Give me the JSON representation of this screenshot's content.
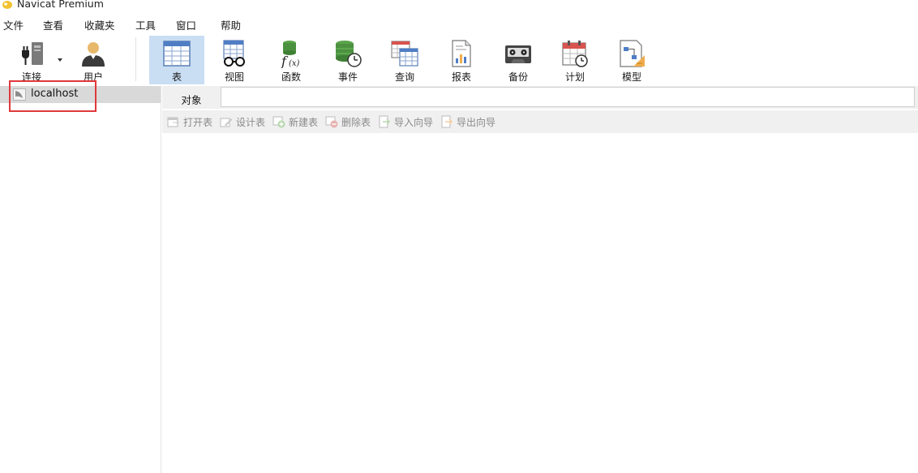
{
  "window": {
    "title": "Navicat Premium"
  },
  "menu": [
    "文件",
    "查看",
    "收藏夹",
    "工具",
    "窗口",
    "帮助"
  ],
  "toolbar": {
    "connect_label": "连接",
    "user_label": "用户",
    "table_label": "表",
    "view_label": "视图",
    "function_label": "函数",
    "event_label": "事件",
    "query_label": "查询",
    "report_label": "报表",
    "backup_label": "备份",
    "schedule_label": "计划",
    "model_label": "模型"
  },
  "sidebar": {
    "connections": [
      {
        "label": "localhost"
      }
    ]
  },
  "tabs": {
    "object_label": "对象"
  },
  "actions": {
    "open_table": "打开表",
    "design_table": "设计表",
    "new_table": "新建表",
    "delete_table": "删除表",
    "import_wizard": "导入向导",
    "export_wizard": "导出向导"
  },
  "colors": {
    "active_toolbar_bg": "#c9def3",
    "selection_bg": "#d9d9d9",
    "highlight_border": "#e0383b",
    "toolbar_bg": "#f0f0f0"
  }
}
